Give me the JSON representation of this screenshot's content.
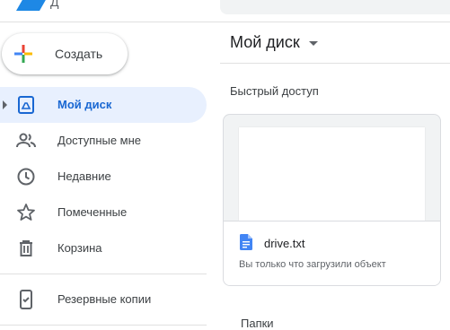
{
  "header": {
    "logo_text": "Д",
    "logo_icon": "drive-logo-icon",
    "search_icon": "search-bar"
  },
  "sidebar": {
    "create_label": "Создать",
    "create_icon": "plus-multicolor-icon",
    "items": [
      {
        "label": "Мой диск",
        "icon": "my-drive-icon",
        "active": true
      },
      {
        "label": "Доступные мне",
        "icon": "people-icon",
        "active": false
      },
      {
        "label": "Недавние",
        "icon": "clock-icon",
        "active": false
      },
      {
        "label": "Помеченные",
        "icon": "star-icon",
        "active": false
      },
      {
        "label": "Корзина",
        "icon": "trash-icon",
        "active": false
      }
    ],
    "backup_label": "Резервные копии",
    "backup_icon": "backup-icon"
  },
  "main": {
    "title": "Мой диск",
    "quick_access_title": "Быстрый доступ",
    "quick_access_file": {
      "name": "drive.txt",
      "subtitle": "Вы только что загрузили объект",
      "icon": "doc-file-icon"
    },
    "folders_title": "Папки"
  },
  "colors": {
    "accent": "#1967d2",
    "active_bg": "#e8f0fe",
    "doc_blue": "#4285f4"
  }
}
